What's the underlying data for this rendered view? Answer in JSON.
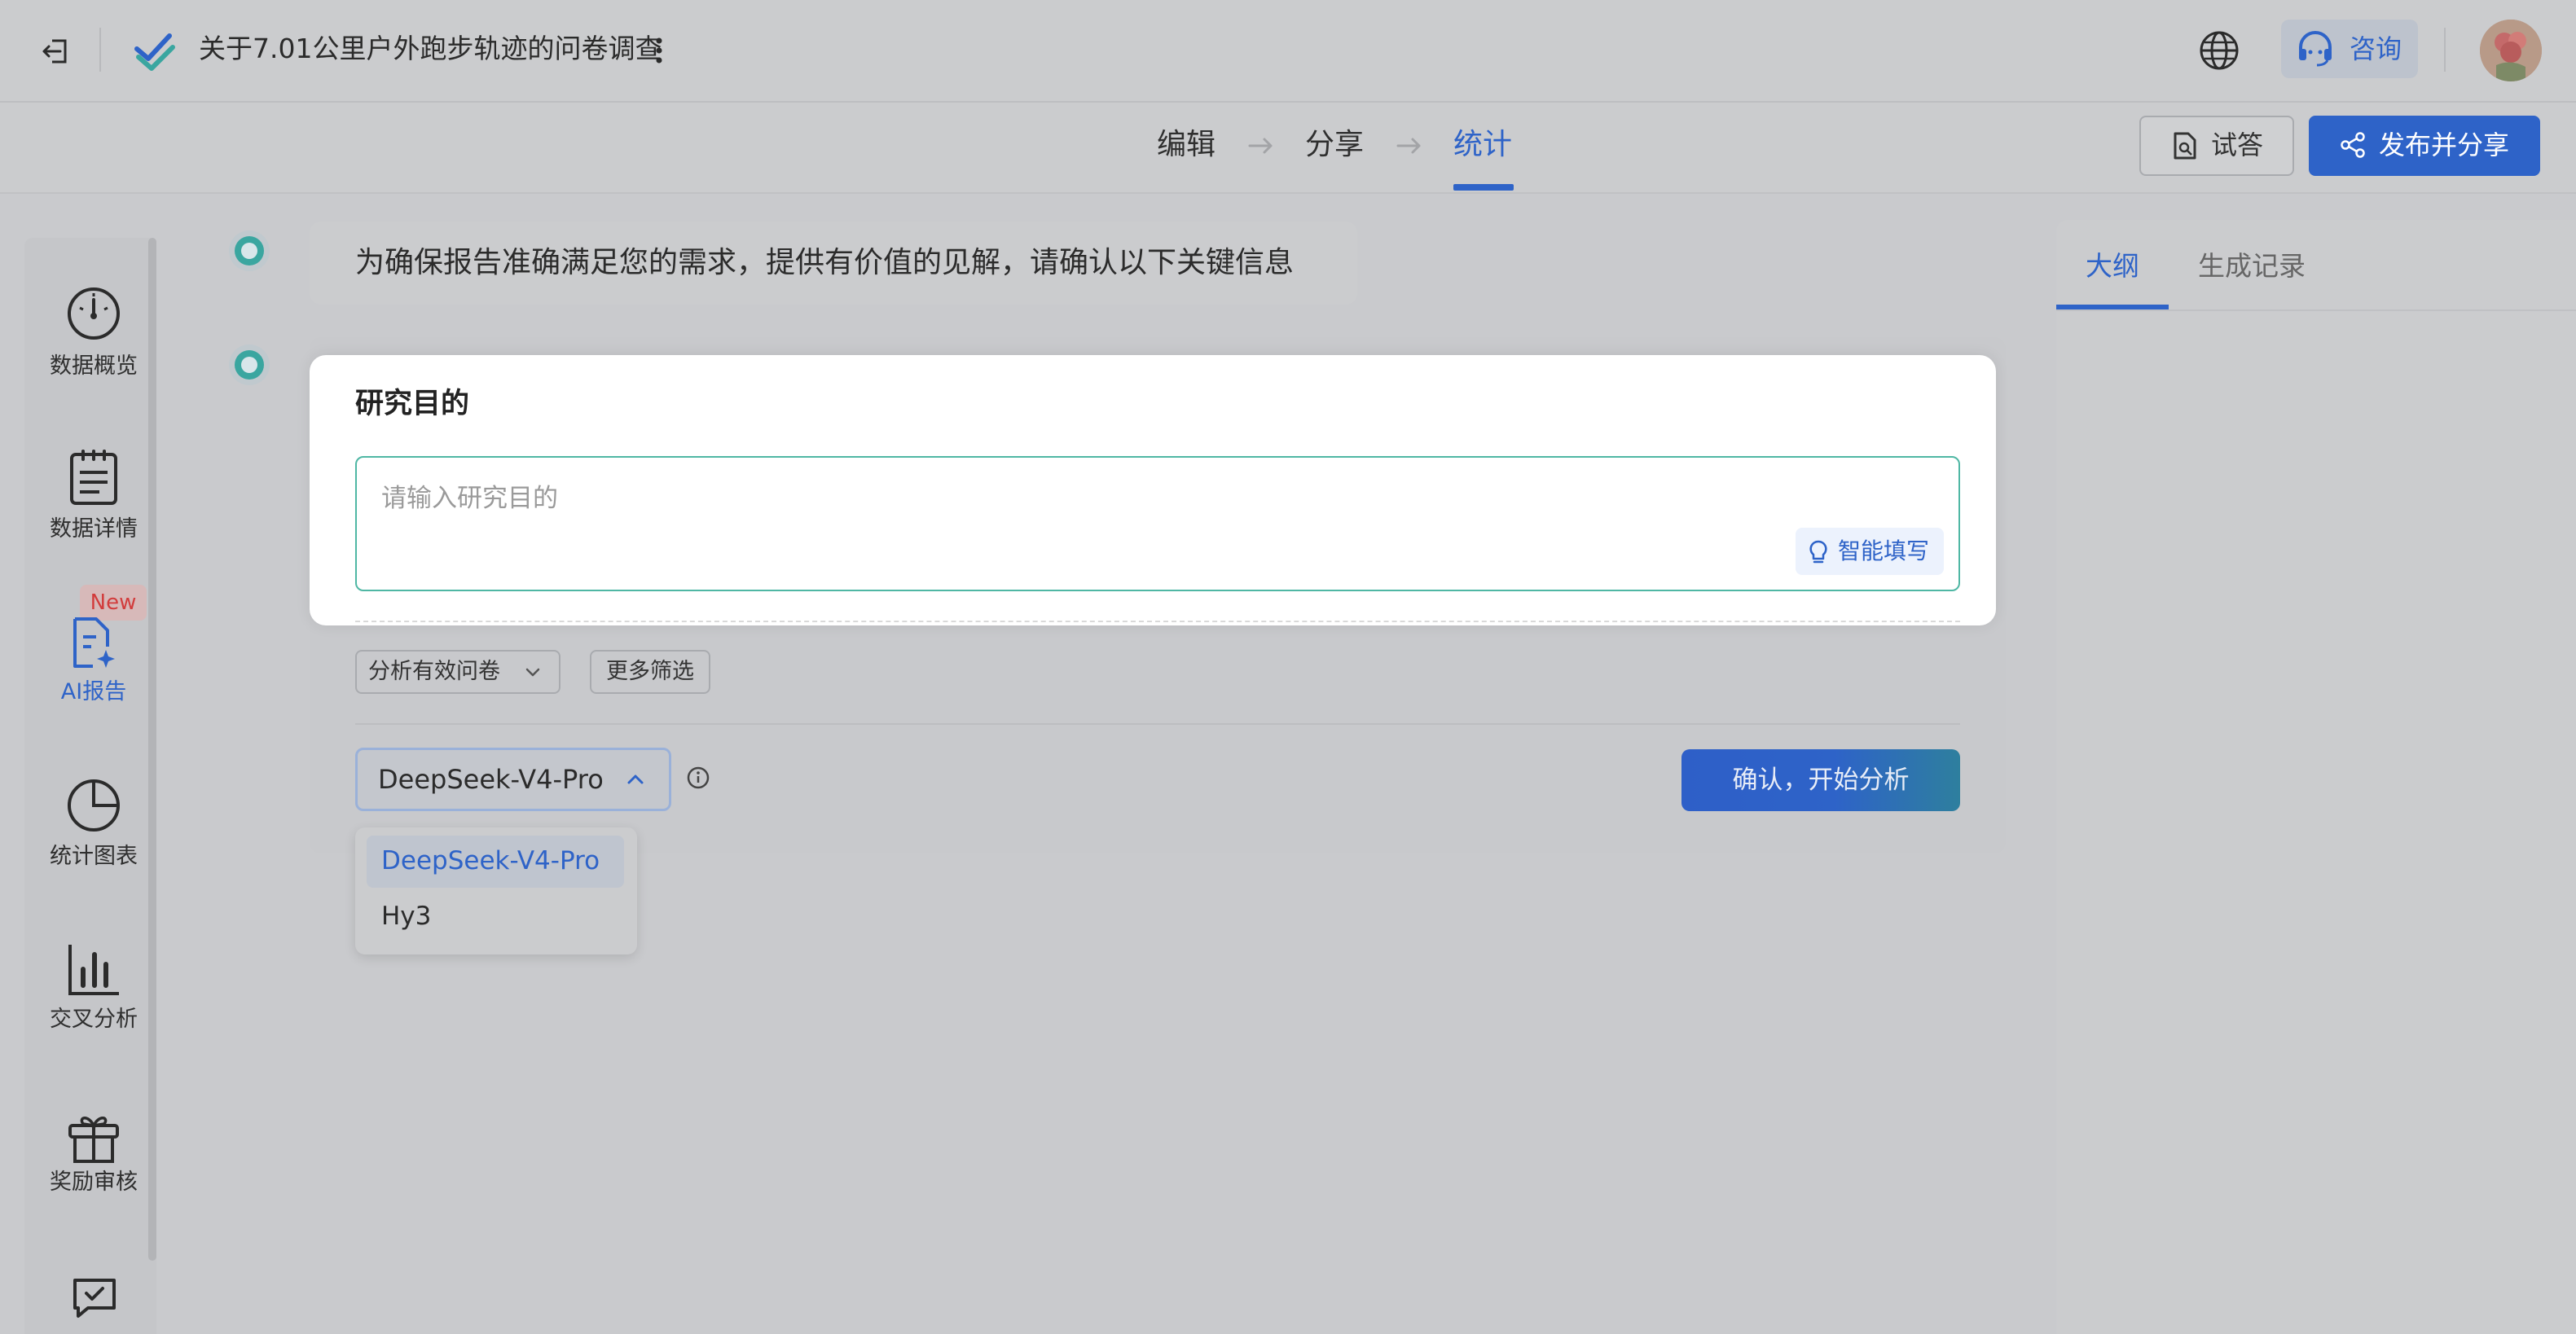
{
  "header": {
    "title": "关于7.01公里户外跑步轨迹的问卷调查",
    "consult_label": "咨询"
  },
  "steps": [
    {
      "label": "编辑",
      "active": false
    },
    {
      "label": "分享",
      "active": false
    },
    {
      "label": "统计",
      "active": true
    }
  ],
  "actions": {
    "try_label": "试答",
    "publish_label": "发布并分享"
  },
  "sidebar": {
    "items": [
      {
        "label": "数据概览",
        "icon": "gauge-icon"
      },
      {
        "label": "数据详情",
        "icon": "clipboard-icon"
      },
      {
        "label": "AI报告",
        "icon": "ai-report-icon",
        "active": true,
        "badge": "New"
      },
      {
        "label": "统计图表",
        "icon": "pie-chart-icon"
      },
      {
        "label": "交叉分析",
        "icon": "bar-chart-icon"
      },
      {
        "label": "奖励审核",
        "icon": "gift-icon"
      }
    ]
  },
  "main": {
    "message": "为确保报告准确满足您的需求，提供有价值的见解，请确认以下关键信息",
    "purpose": {
      "title": "研究目的",
      "value": "",
      "placeholder": "请输入研究目的",
      "smart_fill_label": "智能填写"
    },
    "filters": {
      "valid_filter_label": "分析有效问卷",
      "more_filter_label": "更多筛选"
    },
    "model": {
      "selected": "DeepSeek-V4-Pro",
      "options": [
        "DeepSeek-V4-Pro",
        "Hy3"
      ]
    },
    "confirm_label": "确认，开始分析"
  },
  "right_panel": {
    "tabs": [
      {
        "label": "大纲",
        "active": true
      },
      {
        "label": "生成记录",
        "active": false
      }
    ]
  },
  "colors": {
    "accent": "#2e63c8",
    "badge_text": "#d23c3c",
    "input_border": "#4fb7a4"
  }
}
